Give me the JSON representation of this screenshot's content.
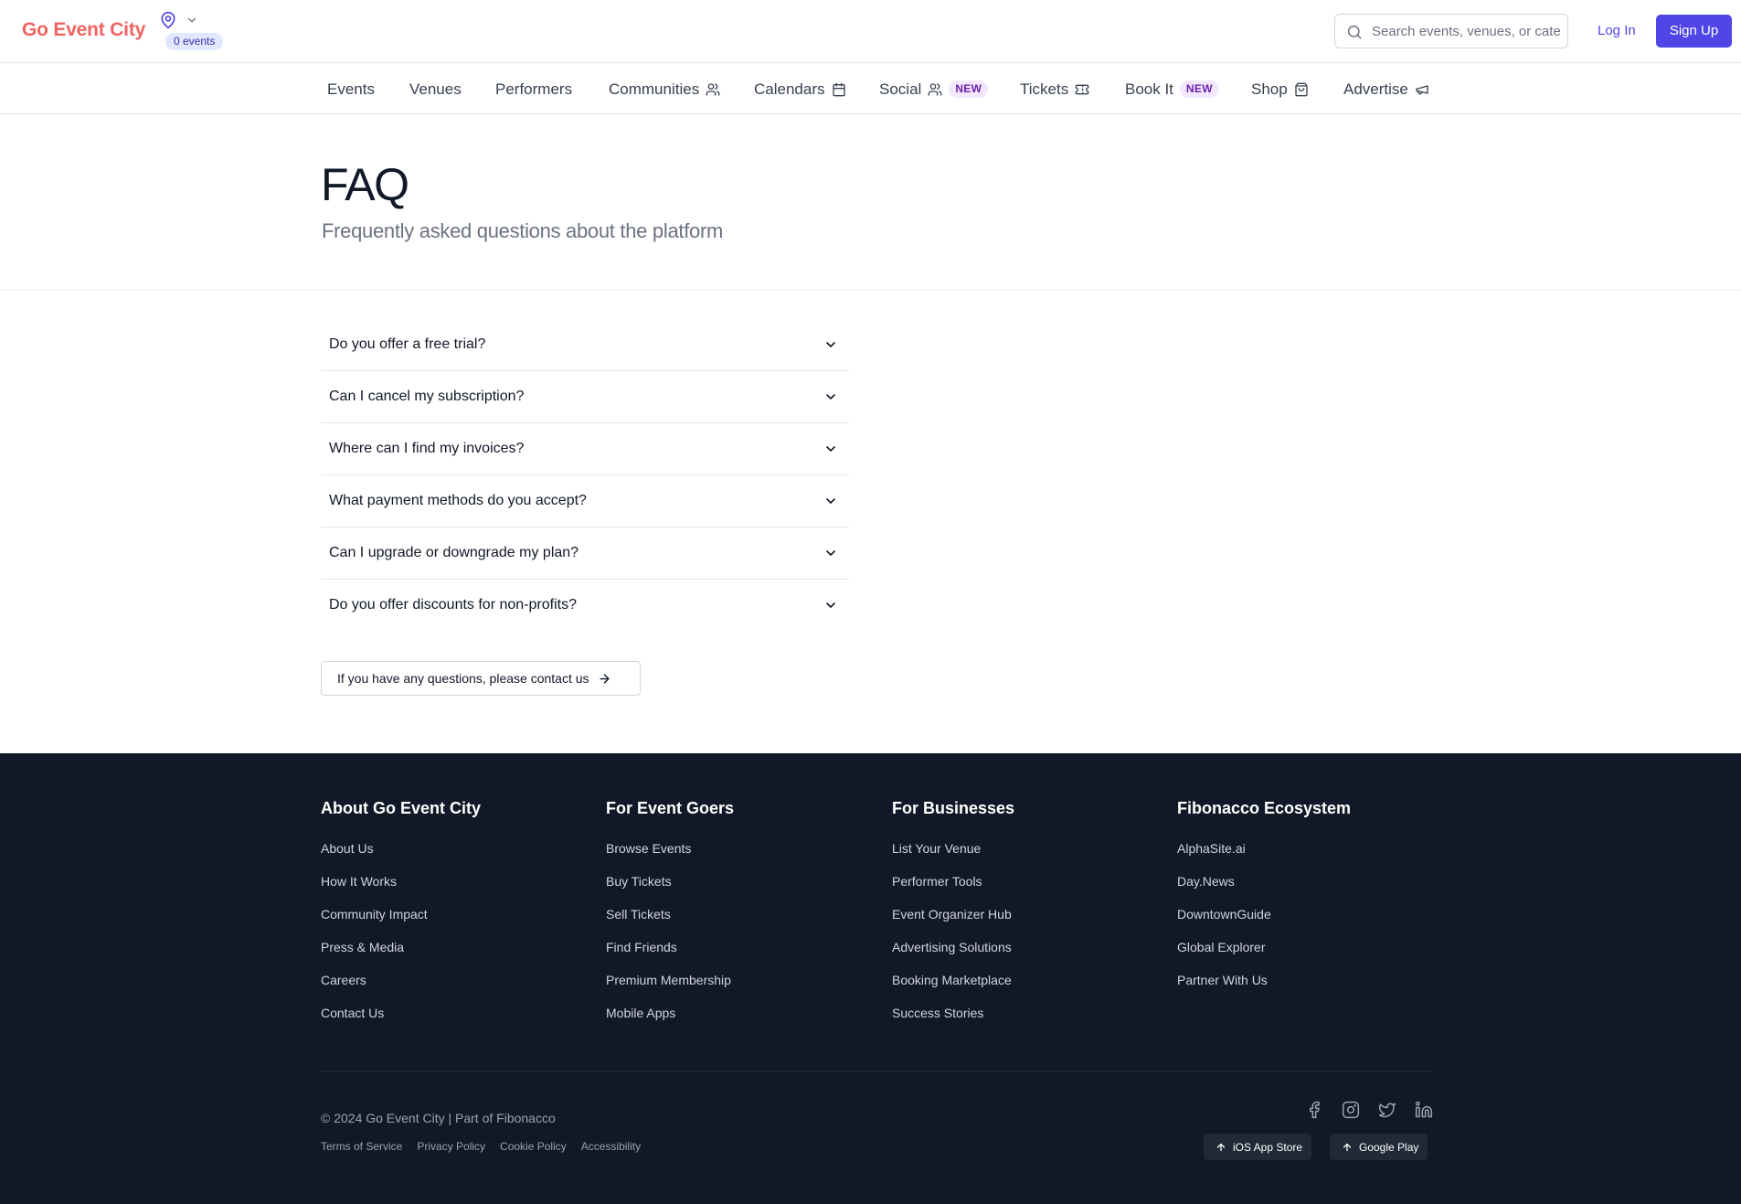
{
  "header": {
    "logo": "Go Event City",
    "events_badge": "0 events",
    "search_placeholder": "Search events, venues, or categories...",
    "login_label": "Log In",
    "signup_label": "Sign Up"
  },
  "nav": {
    "items": [
      {
        "label": "Events",
        "icon": ""
      },
      {
        "label": "Venues",
        "icon": ""
      },
      {
        "label": "Performers",
        "icon": ""
      },
      {
        "label": "Communities",
        "icon": "users-icon"
      },
      {
        "label": "Calendars",
        "icon": "calendar-icon"
      },
      {
        "label": "Social",
        "icon": "users-icon",
        "badge": "NEW"
      },
      {
        "label": "Tickets",
        "icon": "ticket-icon"
      },
      {
        "label": "Book It",
        "icon": "",
        "badge": "NEW"
      },
      {
        "label": "Shop",
        "icon": "shopping-bag-icon"
      },
      {
        "label": "Advertise",
        "icon": "megaphone-icon"
      }
    ]
  },
  "hero": {
    "title": "FAQ",
    "subtitle": "Frequently asked questions about the platform"
  },
  "faq": {
    "questions": [
      "Do you offer a free trial?",
      "Can I cancel my subscription?",
      "Where can I find my invoices?",
      "What payment methods do you accept?",
      "Can I upgrade or downgrade my plan?",
      "Do you offer discounts for non-profits?"
    ],
    "contact_label": "If you have any questions, please contact us"
  },
  "footer": {
    "columns": [
      {
        "heading": "About Go Event City",
        "links": [
          "About Us",
          "How It Works",
          "Community Impact",
          "Press & Media",
          "Careers",
          "Contact Us"
        ]
      },
      {
        "heading": "For Event Goers",
        "links": [
          "Browse Events",
          "Buy Tickets",
          "Sell Tickets",
          "Find Friends",
          "Premium Membership",
          "Mobile Apps"
        ]
      },
      {
        "heading": "For Businesses",
        "links": [
          "List Your Venue",
          "Performer Tools",
          "Event Organizer Hub",
          "Advertising Solutions",
          "Booking Marketplace",
          "Success Stories"
        ]
      },
      {
        "heading": "Fibonacco Ecosystem",
        "links": [
          "AlphaSite.ai",
          "Day.News",
          "DowntownGuide",
          "Global Explorer",
          "Partner With Us"
        ]
      }
    ],
    "copyright": "© 2024 Go Event City | Part of Fibonacco",
    "legal_links": [
      "Terms of Service",
      "Privacy Policy",
      "Cookie Policy",
      "Accessibility"
    ],
    "socials": [
      "facebook-icon",
      "instagram-icon",
      "twitter-icon",
      "linkedin-icon"
    ],
    "store_buttons": [
      "iOS App Store",
      "Google Play"
    ]
  },
  "colors": {
    "brand_logo": "#ef6461",
    "accent": "#4f46e5",
    "footer_bg": "#111827",
    "new_badge_bg": "#f3e8ff",
    "new_badge_text": "#6b21a8"
  }
}
